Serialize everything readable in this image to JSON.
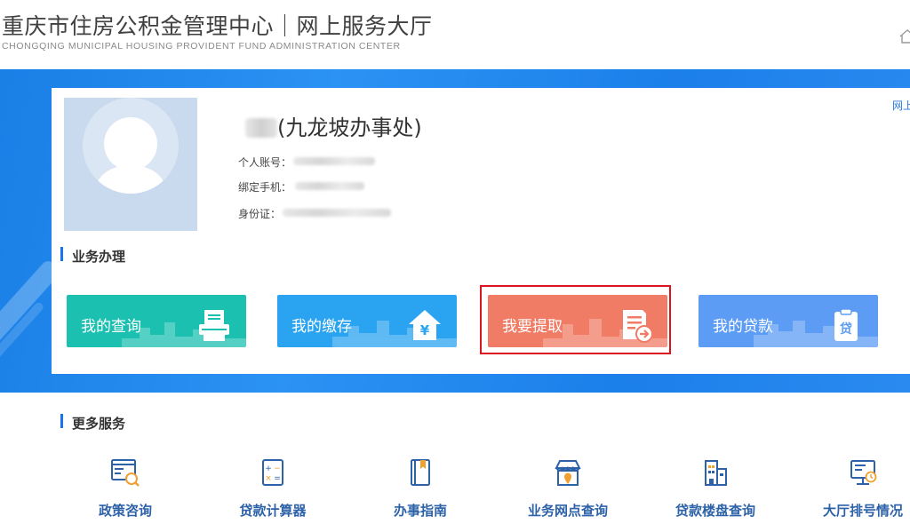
{
  "header": {
    "title_cn": "重庆市住房公积金管理中心｜网上服务大厅",
    "title_en": "CHONGQING MUNICIPAL HOUSING PROVIDENT FUND ADMINISTRATION CENTER"
  },
  "profile": {
    "name_suffix": "(九龙坡办事处)",
    "account_label": "个人账号：",
    "phone_label": "绑定手机：",
    "id_label": "身份证："
  },
  "side_link": "网上",
  "business": {
    "title": "业务办理",
    "tiles": [
      {
        "label": "我的查询",
        "color": "#1cc0b0"
      },
      {
        "label": "我的缴存",
        "color": "#2aa3f0"
      },
      {
        "label": "我要提取",
        "color": "#f07c66"
      },
      {
        "label": "我的贷款",
        "color": "#5d9cf5"
      }
    ]
  },
  "more": {
    "title": "更多服务",
    "items": [
      {
        "label": "政策咨询",
        "icon": "policy-browser-search-icon"
      },
      {
        "label": "贷款计算器",
        "icon": "calculator-icon"
      },
      {
        "label": "办事指南",
        "icon": "guide-book-icon"
      },
      {
        "label": "业务网点查询",
        "icon": "branch-location-icon"
      },
      {
        "label": "贷款楼盘查询",
        "icon": "building-icon"
      },
      {
        "label": "大厅排号情况",
        "icon": "queue-monitor-icon"
      }
    ]
  },
  "colors": {
    "accent": "#1a73e8",
    "banner": "#2b93f3",
    "highlight": "#d9161c",
    "service_text": "#2d62a8"
  }
}
